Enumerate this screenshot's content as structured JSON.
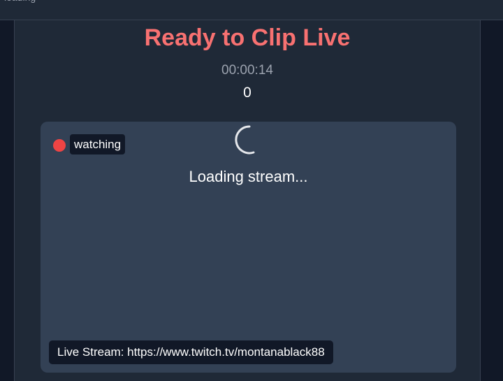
{
  "topbar": {
    "text": "loading"
  },
  "main": {
    "title": "Ready to Clip Live",
    "timer": "00:00:14",
    "count": "0"
  },
  "player": {
    "status": "watching",
    "loading_text": "Loading stream...",
    "stream_label": "Live Stream: https://www.twitch.tv/montanablack88",
    "icons": {
      "live": "live-dot-icon",
      "spinner": "spinner-icon"
    }
  },
  "colors": {
    "background": "#111827",
    "panel": "#1f2937",
    "player": "#334155",
    "accent": "#f87171",
    "live_dot": "#ef4444"
  }
}
